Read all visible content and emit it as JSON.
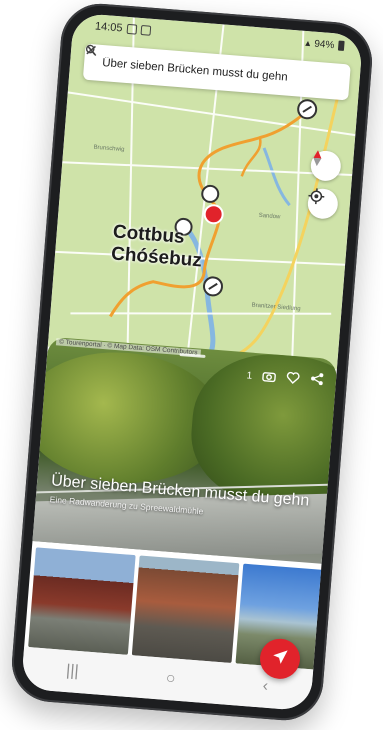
{
  "status_bar": {
    "time": "14:05",
    "battery": "94%"
  },
  "search": {
    "query": "Über sieben Brücken musst du gehn"
  },
  "map": {
    "city_line1": "Cottbus",
    "city_line2": "Chóśebuz",
    "labels": [
      "Brunschwig",
      "Sandow",
      "Branitzer Siedlung"
    ],
    "attribution": "© Tourenportal · © Map Data: OSM Contributors"
  },
  "hero": {
    "title": "Über sieben Brücken musst du gehn",
    "subtitle": "Eine Radwanderung zu Spreewaldmühle",
    "photo_count": "1"
  },
  "icons": {
    "search": "search-icon",
    "close": "close-icon",
    "compass": "compass-icon",
    "locate": "locate-icon",
    "camera": "camera-icon",
    "heart": "heart-icon",
    "share": "share-icon",
    "navigate": "navigate-arrow-icon"
  },
  "colors": {
    "route": "#f0a030",
    "accent": "#e1232b",
    "map_bg": "#cfe3a9"
  }
}
